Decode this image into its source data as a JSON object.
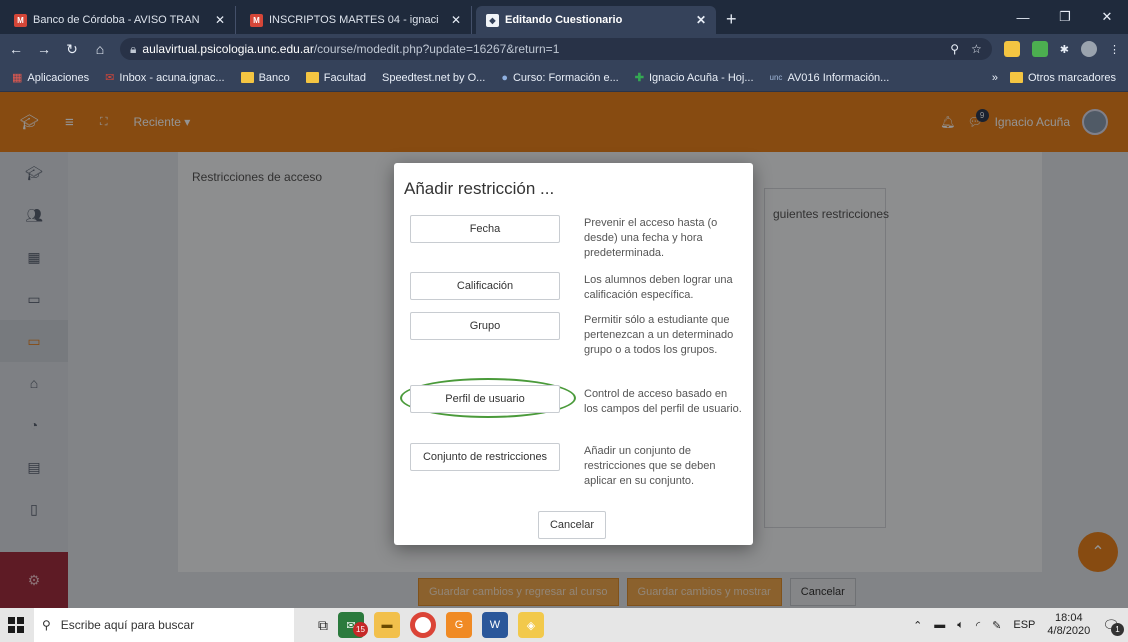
{
  "browser": {
    "tabs": [
      {
        "title": "Banco de Córdoba - AVISO TRAN",
        "favicon": "gmail-icon",
        "active": false
      },
      {
        "title": "INSCRIPTOS MARTES 04 - ignaci",
        "favicon": "gmail-icon",
        "active": false
      },
      {
        "title": "Editando Cuestionario",
        "favicon": "shield-icon",
        "active": true
      }
    ],
    "new_tab_label": "+",
    "url_host": "aulavirtual.psicologia.unc.edu.ar",
    "url_path": "/course/modedit.php?update=16267&return=1",
    "bookmarks": [
      {
        "label": "Aplicaciones",
        "icon": "apps-grid-icon"
      },
      {
        "label": "Inbox - acuna.ignac...",
        "icon": "gmail-icon"
      },
      {
        "label": "Banco",
        "icon": "folder-icon"
      },
      {
        "label": "Facultad",
        "icon": "folder-icon"
      },
      {
        "label": "Speedtest.net by O...",
        "icon": "speedtest-icon"
      },
      {
        "label": "Curso: Formación e...",
        "icon": "course-icon"
      },
      {
        "label": "Ignacio Acuña - Hoj...",
        "icon": "sheets-icon"
      },
      {
        "label": "AV016 Información...",
        "icon": "unc-icon"
      }
    ],
    "bookmarks_overflow": "»",
    "other_bookmarks": "Otros marcadores"
  },
  "moodle": {
    "recent_label": "Reciente ▾",
    "user_name": "Ignacio Acuña",
    "message_count": "9",
    "section_label": "Restricciones de acceso",
    "behind_text": "guientes restricciones",
    "buttons": {
      "save_return": "Guardar cambios y regresar al curso",
      "save_show": "Guardar cambios y mostrar",
      "cancel": "Cancelar"
    }
  },
  "modal": {
    "title": "Añadir restricción ...",
    "options": [
      {
        "label": "Fecha",
        "desc": "Prevenir el acceso hasta (o desde) una fecha y hora predeterminada."
      },
      {
        "label": "Calificación",
        "desc": "Los alumnos deben lograr una calificación específica."
      },
      {
        "label": "Grupo",
        "desc": "Permitir sólo a estudiante que pertenezcan a un determinado grupo o a todos los grupos."
      },
      {
        "label": "Perfil de usuario",
        "desc": "Control de acceso basado en los campos del perfil de usuario."
      },
      {
        "label": "Conjunto de restricciones",
        "desc": "Añadir un conjunto de restricciones que se deben aplicar en su conjunto."
      }
    ],
    "highlighted_option": "Perfil de usuario",
    "cancel_label": "Cancelar"
  },
  "taskbar": {
    "search_placeholder": "Escribe aquí para buscar",
    "language": "ESP",
    "time": "18:04",
    "date": "4/8/2020",
    "mail_badge": "15",
    "notification_count": "1"
  },
  "colors": {
    "moodle_orange": "#e8811e",
    "highlight_green": "#4a9a3a"
  }
}
